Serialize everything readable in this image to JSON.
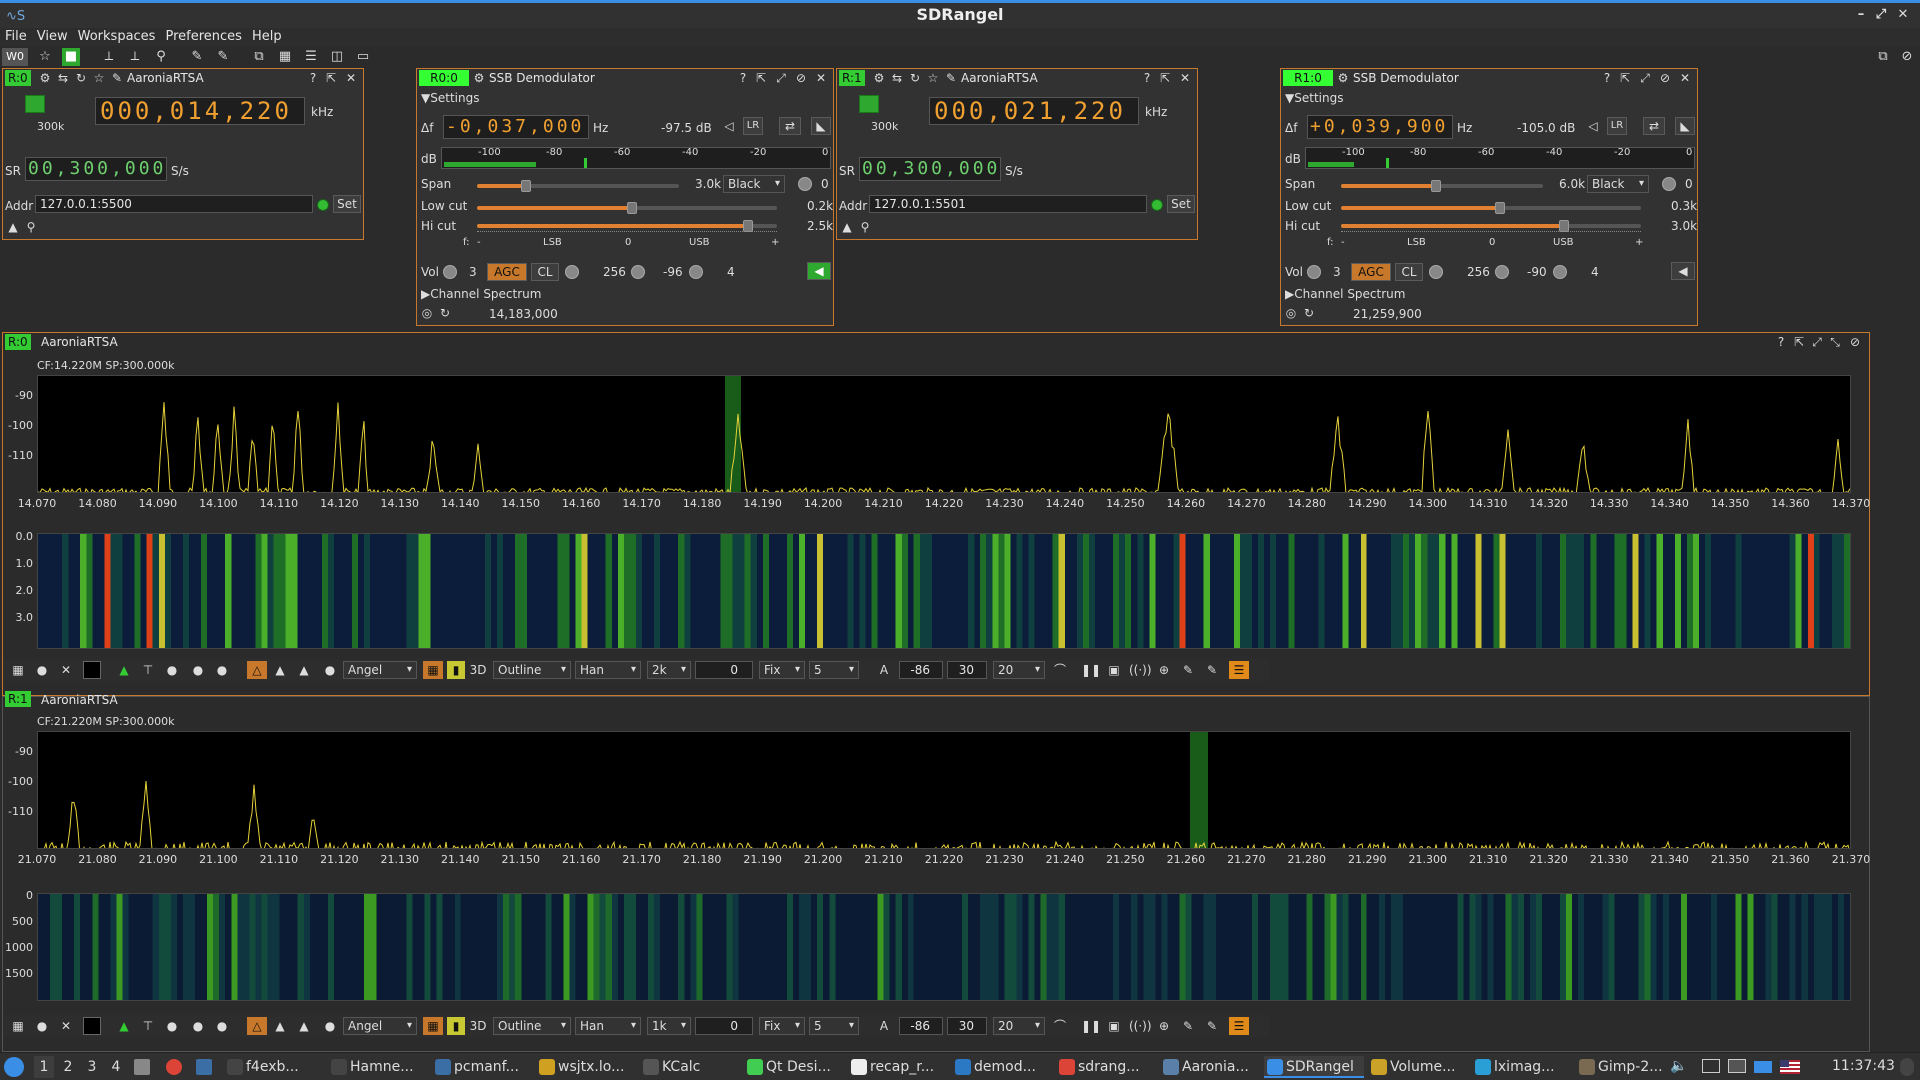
{
  "app": {
    "title": "SDRangel"
  },
  "menu": [
    "File",
    "View",
    "Workspaces",
    "Preferences",
    "Help"
  ],
  "workspace_label": "W0",
  "dev0": {
    "tag": "R:0",
    "name": "AaroniaRTSA",
    "freq": "000,014,220",
    "unit": "kHz",
    "rate_small": "300k",
    "sr_label": "SR",
    "sr": "00,300,000",
    "sr_unit": "S/s",
    "addr_label": "Addr",
    "addr": "127.0.0.1:5500",
    "set": "Set"
  },
  "dev1": {
    "tag": "R:1",
    "name": "AaroniaRTSA",
    "freq": "000,021,220",
    "unit": "kHz",
    "rate_small": "300k",
    "sr_label": "SR",
    "sr": "00,300,000",
    "sr_unit": "S/s",
    "addr_label": "Addr",
    "addr": "127.0.0.1:5501",
    "set": "Set"
  },
  "demod0": {
    "tag": "R0:0",
    "name": "SSB Demodulator",
    "settings": "Settings",
    "df_label": "Δf",
    "df": "-0,037,000",
    "df_unit": "Hz",
    "power": "-97.5 dB",
    "db_label": "dB",
    "db_ticks": [
      "-100",
      "-80",
      "-60",
      "-40",
      "-20",
      "0"
    ],
    "span_label": "Span",
    "span": "3.0k",
    "palette": "Black",
    "span_val": "0",
    "lowcut_label": "Low cut",
    "lowcut": "0.2k",
    "hicut_label": "Hi cut",
    "hicut": "2.5k",
    "scale": [
      "f:",
      "-",
      "LSB",
      "0",
      "USB",
      "+"
    ],
    "vol_label": "Vol",
    "vol": "3",
    "agc": "AGC",
    "cl": "CL",
    "agc_n": "256",
    "agc_db": "-96",
    "agc_t": "4",
    "chspec": "Channel Spectrum",
    "chfreq": "14,183,000"
  },
  "demod1": {
    "tag": "R1:0",
    "name": "SSB Demodulator",
    "settings": "Settings",
    "df_label": "Δf",
    "df": "+0,039,900",
    "df_unit": "Hz",
    "power": "-105.0 dB",
    "db_label": "dB",
    "db_ticks": [
      "-100",
      "-80",
      "-60",
      "-40",
      "-20",
      "0"
    ],
    "span_label": "Span",
    "span": "6.0k",
    "palette": "Black",
    "span_val": "0",
    "lowcut_label": "Low cut",
    "lowcut": "0.3k",
    "hicut_label": "Hi cut",
    "hicut": "3.0k",
    "scale": [
      "f:",
      "-",
      "LSB",
      "0",
      "USB",
      "+"
    ],
    "vol_label": "Vol",
    "vol": "3",
    "agc": "AGC",
    "cl": "CL",
    "agc_n": "256",
    "agc_db": "-90",
    "agc_t": "4",
    "chspec": "Channel Spectrum",
    "chfreq": "21,259,900"
  },
  "spec0": {
    "tag": "R:0",
    "name": "AaroniaRTSA",
    "info": "CF:14.220M SP:300.000k",
    "db": [
      "-90",
      "-100",
      "-110"
    ],
    "freqs": [
      "14.070",
      "14.080",
      "14.090",
      "14.100",
      "14.110",
      "14.120",
      "14.130",
      "14.140",
      "14.150",
      "14.160",
      "14.170",
      "14.180",
      "14.190",
      "14.200",
      "14.210",
      "14.220",
      "14.230",
      "14.240",
      "14.250",
      "14.260",
      "14.270",
      "14.280",
      "14.290",
      "14.300",
      "14.310",
      "14.320",
      "14.330",
      "14.340",
      "14.350",
      "14.360",
      "14.370"
    ],
    "wf": [
      "0.0",
      "1.0",
      "2.0",
      "3.0"
    ],
    "ctrl": {
      "palette": "Angel",
      "style": "Outline",
      "window": "Han",
      "fft": "2k",
      "ov": "0",
      "fix": "Fix",
      "avg": "5",
      "a": "A",
      "ref": "-86",
      "range": "30",
      "rate": "20"
    }
  },
  "spec1": {
    "tag": "R:1",
    "name": "AaroniaRTSA",
    "info": "CF:21.220M SP:300.000k",
    "db": [
      "-90",
      "-100",
      "-110"
    ],
    "freqs": [
      "21.070",
      "21.080",
      "21.090",
      "21.100",
      "21.110",
      "21.120",
      "21.130",
      "21.140",
      "21.150",
      "21.160",
      "21.170",
      "21.180",
      "21.190",
      "21.200",
      "21.210",
      "21.220",
      "21.230",
      "21.240",
      "21.250",
      "21.260",
      "21.270",
      "21.280",
      "21.290",
      "21.300",
      "21.310",
      "21.320",
      "21.330",
      "21.340",
      "21.350",
      "21.360",
      "21.370"
    ],
    "wf": [
      "0",
      "500",
      "1000",
      "1500"
    ],
    "ctrl": {
      "palette": "Angel",
      "style": "Outline",
      "window": "Han",
      "fft": "1k",
      "ov": "0",
      "fix": "Fix",
      "avg": "5",
      "a": "A",
      "ref": "-86",
      "range": "30",
      "rate": "20"
    }
  },
  "taskbar": {
    "workspaces": [
      "1",
      "2",
      "3",
      "4"
    ],
    "tasks": [
      {
        "label": "f4exb...",
        "color": "#444"
      },
      {
        "label": "Hamne...",
        "color": "#444"
      },
      {
        "label": "pcmanf...",
        "color": "#3a6ea5"
      },
      {
        "label": "wsjtx.lo...",
        "color": "#d0a020"
      },
      {
        "label": "KCalc",
        "color": "#555"
      },
      {
        "label": "Qt Desi...",
        "color": "#41cd52"
      },
      {
        "label": "recap_r...",
        "color": "#eee"
      },
      {
        "label": "demod...",
        "color": "#2b79c5"
      },
      {
        "label": "sdrang...",
        "color": "#db4437"
      },
      {
        "label": "Aaronia...",
        "color": "#5a7fa8"
      },
      {
        "label": "SDRangel",
        "color": "#3a8ee6"
      },
      {
        "label": "Volume...",
        "color": "#c9a227"
      },
      {
        "label": "lximag...",
        "color": "#2a9fd6"
      },
      {
        "label": "Gimp-2...",
        "color": "#7a6a52"
      }
    ],
    "clock": "11:37:43"
  }
}
